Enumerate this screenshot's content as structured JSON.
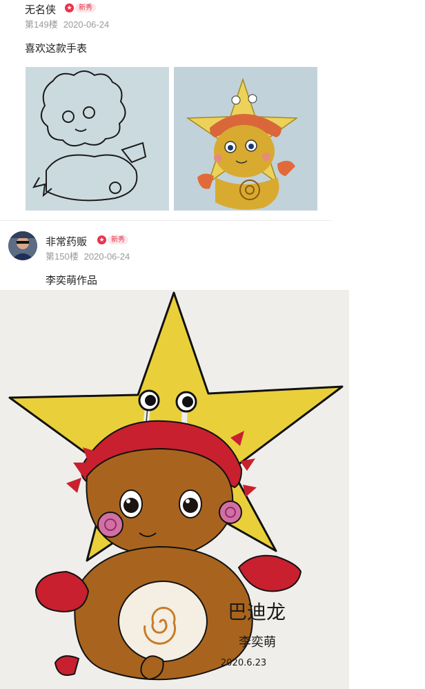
{
  "posts": [
    {
      "username": "无名侠",
      "badge": "新秀",
      "floor": "第149楼",
      "date": "2020-06-24",
      "text": "喜欢这款手表",
      "images": [
        "sketch-drawing",
        "colored-drawing"
      ]
    },
    {
      "username": "非常药贩",
      "badge": "新秀",
      "floor": "第150楼",
      "date": "2020-06-24",
      "text": "李奕萌作品",
      "images": [
        "star-character-drawing"
      ]
    }
  ],
  "drawing": {
    "title": "巴迪龙",
    "signature": "李奕萌",
    "date": "2020.6.23"
  },
  "colors": {
    "badge_red": "#e8334a",
    "meta_gray": "#999999",
    "star_yellow": "#e9cf3a",
    "helmet_red": "#c8202e",
    "body_brown": "#a8641e"
  }
}
